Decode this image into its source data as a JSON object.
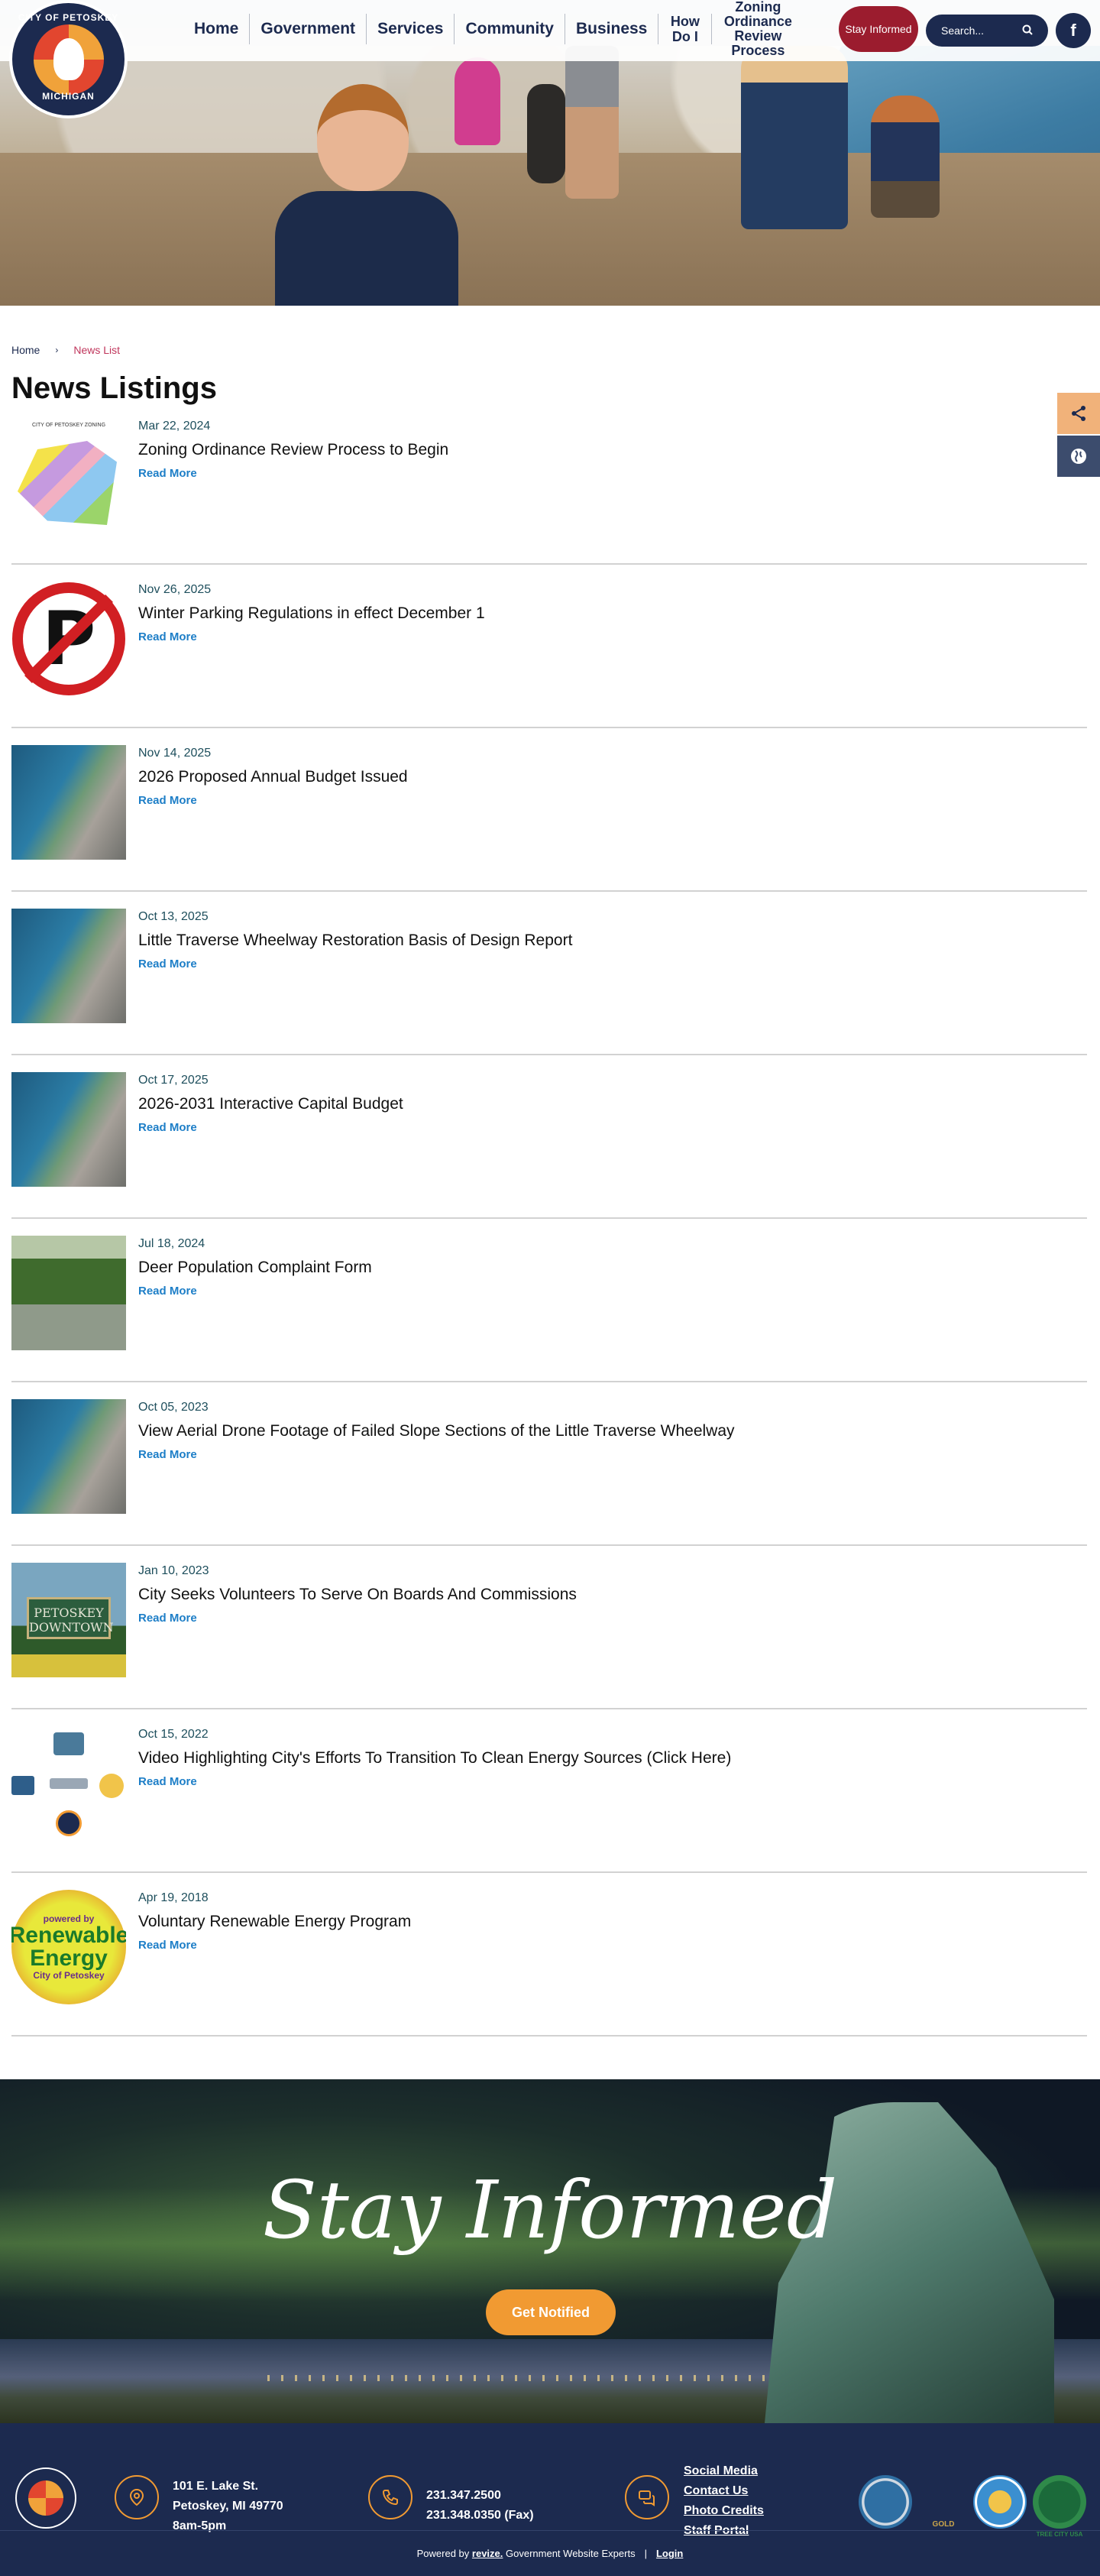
{
  "header": {
    "logo_text_top": "CITY OF PETOSKEY",
    "logo_text_bottom": "MICHIGAN",
    "nav": [
      "Home",
      "Government",
      "Services",
      "Community",
      "Business",
      "How Do I",
      "Zoning Ordinance Review Process"
    ],
    "stay_informed_label": "Stay Informed",
    "search_placeholder": "Search...",
    "facebook_label": "f"
  },
  "breadcrumb": {
    "home": "Home",
    "separator": "›",
    "current": "News List"
  },
  "page_title": "News Listings",
  "read_more_label": "Read More",
  "news": [
    {
      "date": "Mar 22, 2024",
      "title": "Zoning Ordinance Review Process to Begin",
      "thumb": "zoning-map"
    },
    {
      "date": "Nov 26, 2025",
      "title": "Winter Parking Regulations in effect December 1",
      "thumb": "no-parking"
    },
    {
      "date": "Nov 14, 2025",
      "title": "2026 Proposed Annual Budget Issued",
      "thumb": "aerial-bay"
    },
    {
      "date": "Oct 13, 2025",
      "title": "Little Traverse Wheelway Restoration Basis of Design Report",
      "thumb": "aerial-bay"
    },
    {
      "date": "Oct 17, 2025",
      "title": "2026-2031 Interactive Capital Budget",
      "thumb": "aerial-bay"
    },
    {
      "date": "Jul 18, 2024",
      "title": "Deer Population Complaint Form",
      "thumb": "deer-yard"
    },
    {
      "date": "Oct 05, 2023",
      "title": "View Aerial Drone Footage of Failed Slope Sections of the Little Traverse Wheelway",
      "thumb": "aerial-bay"
    },
    {
      "date": "Jan 10, 2023",
      "title": "City Seeks Volunteers To Serve On Boards And Commissions",
      "thumb": "downtown-sign"
    },
    {
      "date": "Oct 15, 2022",
      "title": "Video Highlighting City's Efforts To Transition To Clean Energy Sources (Click Here)",
      "thumb": "logos"
    },
    {
      "date": "Apr 19, 2018",
      "title": "Voluntary Renewable Energy Program",
      "thumb": "renewable-energy"
    }
  ],
  "thumb_text": {
    "zoning_caption": "CITY OF PETOSKEY ZONING",
    "parking_letter": "P",
    "sign_text": "PETOSKEY DOWNTOWN",
    "energy_top": "powered by",
    "energy_main": "Renewable Energy",
    "energy_bottom": "City of Petoskey"
  },
  "side_tools": {
    "share_icon": "share-icon",
    "globe_icon": "globe-icon"
  },
  "stay_section": {
    "title": "Stay Informed",
    "button_label": "Get Notified"
  },
  "footer": {
    "address_line1": "101 E. Lake St.",
    "address_line2": "Petoskey, MI 49770",
    "hours": "8am-5pm",
    "phone": "231.347.2500",
    "fax": "231.348.0350 (Fax)",
    "links": [
      "Social Media",
      "Contact Us",
      "Photo Credits",
      "Staff Portal"
    ],
    "powered_prefix": "Powered by",
    "powered_brand": "revize.",
    "powered_suffix": "Government Website Experts",
    "login": "Login",
    "badge_gold": "GOLD",
    "badge_tree": "TREE CITY USA"
  },
  "colors": {
    "navy": "#1c2a4f",
    "crimson": "#9b1c2e",
    "orange": "#f19a32",
    "link_blue": "#1d7ec7",
    "date_teal": "#1d4e5c"
  }
}
